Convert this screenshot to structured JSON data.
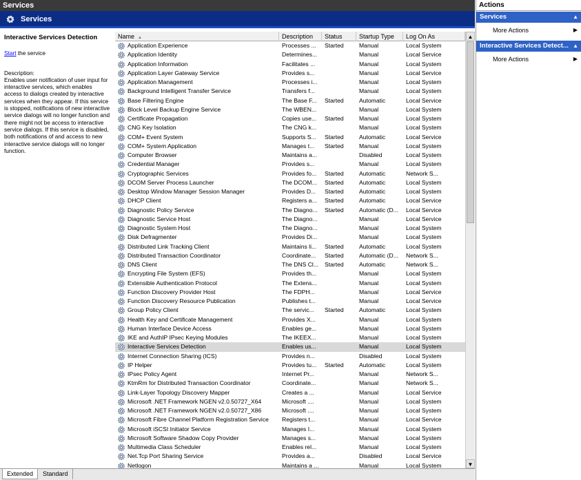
{
  "window": {
    "top_title": "Services",
    "banner_title": "Services"
  },
  "description_pane": {
    "service_name": "Interactive Services Detection",
    "start_link": "Start",
    "start_suffix": " the service",
    "description_label": "Description:",
    "description_text": "Enables user notification of user input for interactive services, which enables access to dialogs created by interactive services when they appear. If this service is stopped, notifications of new interactive service dialogs will no longer function and there might not be access to interactive service dialogs. If this service is disabled, both notifications of and access to new interactive service dialogs will no longer function."
  },
  "list": {
    "columns": {
      "name": "Name",
      "description": "Description",
      "status": "Status",
      "startup_type": "Startup Type",
      "log_on_as": "Log On As"
    },
    "sort_indicator": "▲",
    "selected_index": 33,
    "rows": [
      {
        "name": "Application Experience",
        "desc": "Processes ...",
        "status": "Started",
        "startup": "Manual",
        "logon": "Local System"
      },
      {
        "name": "Application Identity",
        "desc": "Determines...",
        "status": "",
        "startup": "Manual",
        "logon": "Local Service"
      },
      {
        "name": "Application Information",
        "desc": "Facilitates ...",
        "status": "",
        "startup": "Manual",
        "logon": "Local System"
      },
      {
        "name": "Application Layer Gateway Service",
        "desc": "Provides s...",
        "status": "",
        "startup": "Manual",
        "logon": "Local Service"
      },
      {
        "name": "Application Management",
        "desc": "Processes i...",
        "status": "",
        "startup": "Manual",
        "logon": "Local System"
      },
      {
        "name": "Background Intelligent Transfer Service",
        "desc": "Transfers f...",
        "status": "",
        "startup": "Manual",
        "logon": "Local System"
      },
      {
        "name": "Base Filtering Engine",
        "desc": "The Base F...",
        "status": "Started",
        "startup": "Automatic",
        "logon": "Local Service"
      },
      {
        "name": "Block Level Backup Engine Service",
        "desc": "The WBEN...",
        "status": "",
        "startup": "Manual",
        "logon": "Local System"
      },
      {
        "name": "Certificate Propagation",
        "desc": "Copies use...",
        "status": "Started",
        "startup": "Manual",
        "logon": "Local System"
      },
      {
        "name": "CNG Key Isolation",
        "desc": "The CNG k...",
        "status": "",
        "startup": "Manual",
        "logon": "Local System"
      },
      {
        "name": "COM+ Event System",
        "desc": "Supports S...",
        "status": "Started",
        "startup": "Automatic",
        "logon": "Local Service"
      },
      {
        "name": "COM+ System Application",
        "desc": "Manages t...",
        "status": "Started",
        "startup": "Manual",
        "logon": "Local System"
      },
      {
        "name": "Computer Browser",
        "desc": "Maintains a...",
        "status": "",
        "startup": "Disabled",
        "logon": "Local System"
      },
      {
        "name": "Credential Manager",
        "desc": "Provides s...",
        "status": "",
        "startup": "Manual",
        "logon": "Local System"
      },
      {
        "name": "Cryptographic Services",
        "desc": "Provides fo...",
        "status": "Started",
        "startup": "Automatic",
        "logon": "Network S..."
      },
      {
        "name": "DCOM Server Process Launcher",
        "desc": "The DCOM...",
        "status": "Started",
        "startup": "Automatic",
        "logon": "Local System"
      },
      {
        "name": "Desktop Window Manager Session Manager",
        "desc": "Provides D...",
        "status": "Started",
        "startup": "Automatic",
        "logon": "Local System"
      },
      {
        "name": "DHCP Client",
        "desc": "Registers a...",
        "status": "Started",
        "startup": "Automatic",
        "logon": "Local Service"
      },
      {
        "name": "Diagnostic Policy Service",
        "desc": "The Diagno...",
        "status": "Started",
        "startup": "Automatic (D...",
        "logon": "Local Service"
      },
      {
        "name": "Diagnostic Service Host",
        "desc": "The Diagno...",
        "status": "",
        "startup": "Manual",
        "logon": "Local Service"
      },
      {
        "name": "Diagnostic System Host",
        "desc": "The Diagno...",
        "status": "",
        "startup": "Manual",
        "logon": "Local System"
      },
      {
        "name": "Disk Defragmenter",
        "desc": "Provides Di...",
        "status": "",
        "startup": "Manual",
        "logon": "Local System"
      },
      {
        "name": "Distributed Link Tracking Client",
        "desc": "Maintains li...",
        "status": "Started",
        "startup": "Automatic",
        "logon": "Local System"
      },
      {
        "name": "Distributed Transaction Coordinator",
        "desc": "Coordinate...",
        "status": "Started",
        "startup": "Automatic (D...",
        "logon": "Network S..."
      },
      {
        "name": "DNS Client",
        "desc": "The DNS Cl...",
        "status": "Started",
        "startup": "Automatic",
        "logon": "Network S..."
      },
      {
        "name": "Encrypting File System (EFS)",
        "desc": "Provides th...",
        "status": "",
        "startup": "Manual",
        "logon": "Local System"
      },
      {
        "name": "Extensible Authentication Protocol",
        "desc": "The Extens...",
        "status": "",
        "startup": "Manual",
        "logon": "Local System"
      },
      {
        "name": "Function Discovery Provider Host",
        "desc": "The FDPH...",
        "status": "",
        "startup": "Manual",
        "logon": "Local Service"
      },
      {
        "name": "Function Discovery Resource Publication",
        "desc": "Publishes t...",
        "status": "",
        "startup": "Manual",
        "logon": "Local Service"
      },
      {
        "name": "Group Policy Client",
        "desc": "The servic...",
        "status": "Started",
        "startup": "Automatic",
        "logon": "Local System"
      },
      {
        "name": "Health Key and Certificate Management",
        "desc": "Provides X...",
        "status": "",
        "startup": "Manual",
        "logon": "Local System"
      },
      {
        "name": "Human Interface Device Access",
        "desc": "Enables ge...",
        "status": "",
        "startup": "Manual",
        "logon": "Local System"
      },
      {
        "name": "IKE and AuthIP IPsec Keying Modules",
        "desc": "The IKEEX...",
        "status": "",
        "startup": "Manual",
        "logon": "Local System"
      },
      {
        "name": "Interactive Services Detection",
        "desc": "Enables us...",
        "status": "",
        "startup": "Manual",
        "logon": "Local System"
      },
      {
        "name": "Internet Connection Sharing (ICS)",
        "desc": "Provides n...",
        "status": "",
        "startup": "Disabled",
        "logon": "Local System"
      },
      {
        "name": "IP Helper",
        "desc": "Provides tu...",
        "status": "Started",
        "startup": "Automatic",
        "logon": "Local System"
      },
      {
        "name": "IPsec Policy Agent",
        "desc": "Internet Pr...",
        "status": "",
        "startup": "Manual",
        "logon": "Network S..."
      },
      {
        "name": "KtmRm for Distributed Transaction Coordinator",
        "desc": "Coordinate...",
        "status": "",
        "startup": "Manual",
        "logon": "Network S..."
      },
      {
        "name": "Link-Layer Topology Discovery Mapper",
        "desc": "Creates a ...",
        "status": "",
        "startup": "Manual",
        "logon": "Local Service"
      },
      {
        "name": "Microsoft .NET Framework NGEN v2.0.50727_X64",
        "desc": "Microsoft ....",
        "status": "",
        "startup": "Manual",
        "logon": "Local System"
      },
      {
        "name": "Microsoft .NET Framework NGEN v2.0.50727_X86",
        "desc": "Microsoft ....",
        "status": "",
        "startup": "Manual",
        "logon": "Local System"
      },
      {
        "name": "Microsoft Fibre Channel Platform Registration Service",
        "desc": "Registers t...",
        "status": "",
        "startup": "Manual",
        "logon": "Local Service"
      },
      {
        "name": "Microsoft iSCSI Initiator Service",
        "desc": "Manages I...",
        "status": "",
        "startup": "Manual",
        "logon": "Local System"
      },
      {
        "name": "Microsoft Software Shadow Copy Provider",
        "desc": "Manages s...",
        "status": "",
        "startup": "Manual",
        "logon": "Local System"
      },
      {
        "name": "Multimedia Class Scheduler",
        "desc": "Enables rel...",
        "status": "",
        "startup": "Manual",
        "logon": "Local System"
      },
      {
        "name": "Net.Tcp Port Sharing Service",
        "desc": "Provides a...",
        "status": "",
        "startup": "Disabled",
        "logon": "Local Service"
      },
      {
        "name": "Netlogon",
        "desc": "Maintains a ...",
        "status": "",
        "startup": "Manual",
        "logon": "Local System"
      }
    ]
  },
  "tabs": {
    "extended": "Extended",
    "standard": "Standard"
  },
  "actions": {
    "title": "Actions",
    "section1": {
      "header": "Services",
      "item": "More Actions"
    },
    "section2": {
      "header": "Interactive Services Detect...",
      "item": "More Actions"
    }
  },
  "colors": {
    "banner": "#0b2d86",
    "action_header": "#2f62c6",
    "selected_row": "#d9d9d9"
  }
}
